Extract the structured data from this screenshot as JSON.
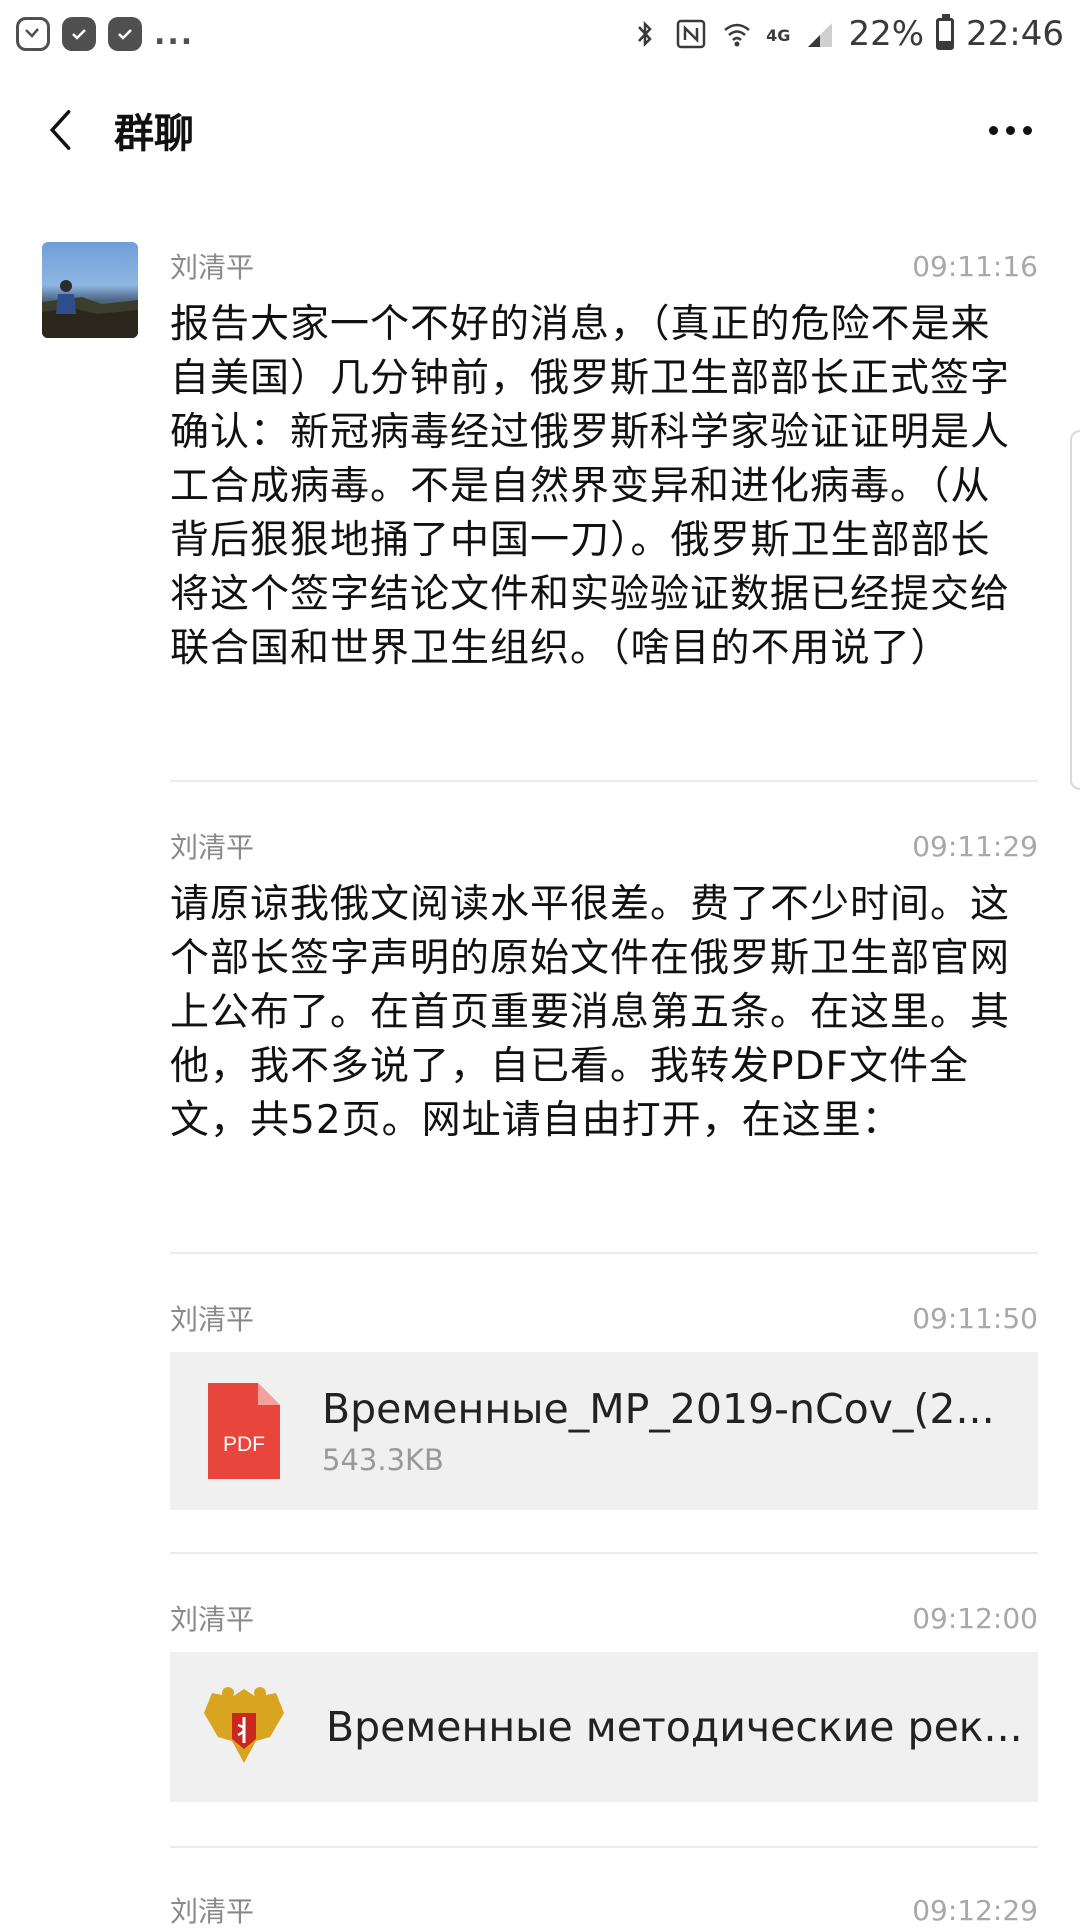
{
  "status_bar": {
    "battery_percent": "22%",
    "battery_level": 0.22,
    "clock": "22:46",
    "network": "4G",
    "overflow": "...",
    "icons": [
      "missed-call-icon",
      "check-notification-icon",
      "check-notification-icon",
      "bluetooth-icon",
      "nfc-icon",
      "wifi-icon",
      "signal-icon",
      "battery-icon"
    ]
  },
  "header": {
    "title": "群聊",
    "back_icon": "back-arrow-icon",
    "more_icon": "more-icon"
  },
  "messages": [
    {
      "sender": "刘清平",
      "time": "09:11:16",
      "text": "报告大家一个不好的消息，（真正的危险不是来自美国）几分钟前，俄罗斯卫生部部长正式签字确认：新冠病毒经过俄罗斯科学家验证证明是人工合成病毒。不是自然界变异和进化病毒。（从背后狠狠地捅了中国一刀）。俄罗斯卫生部部长将这个签字结论文件和实验验证数据已经提交给联合国和世界卫生组织。（啥目的不用说了）"
    },
    {
      "sender": "刘清平",
      "time": "09:11:29",
      "text": "请原谅我俄文阅读水平很差。费了不少时间。这个部长签字声明的原始文件在俄罗斯卫生部官网上公布了。在首页重要消息第五条。在这里。其他，我不多说了，自已看。我转发PDF文件全文，共52页。网址请自由打开，在这里："
    },
    {
      "sender": "刘清平",
      "time": "09:11:50",
      "file_name": "Временные_MP_2019-nCov_(2...",
      "file_size": "543.3KB",
      "file_icon_label": "PDF"
    },
    {
      "sender": "刘清平",
      "time": "09:12:00",
      "link_title": "Временные методические рек..."
    },
    {
      "sender": "刘清平",
      "time": "09:12:29"
    }
  ],
  "colors": {
    "pdf_red": "#e8453c",
    "card_bg": "#f0f0f0",
    "meta_gray": "#8a8a8a"
  }
}
